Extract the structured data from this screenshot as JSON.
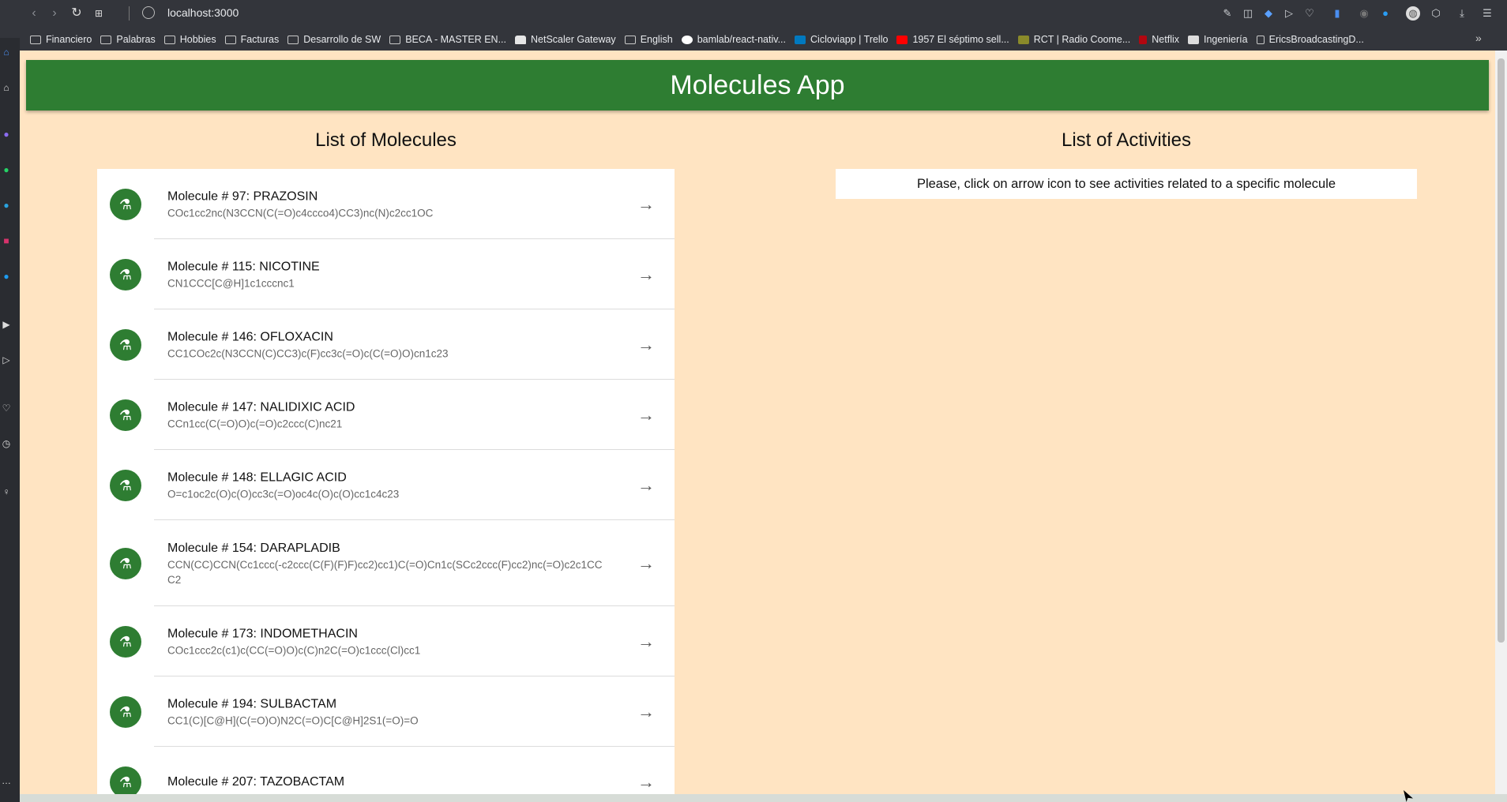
{
  "browser": {
    "url": "localhost:3000",
    "bookmarks": [
      {
        "label": "Financiero",
        "icon": "folder-icon"
      },
      {
        "label": "Palabras",
        "icon": "folder-icon"
      },
      {
        "label": "Hobbies",
        "icon": "folder-icon"
      },
      {
        "label": "Facturas",
        "icon": "folder-icon"
      },
      {
        "label": "Desarrollo de SW",
        "icon": "folder-icon"
      },
      {
        "label": "BECA - MASTER EN...",
        "icon": "folder-icon"
      },
      {
        "label": "NetScaler Gateway",
        "icon": "lock-icon"
      },
      {
        "label": "English",
        "icon": "folder-icon"
      },
      {
        "label": "bamlab/react-nativ...",
        "icon": "github-icon"
      },
      {
        "label": "Cicloviapp | Trello",
        "icon": "trello-icon"
      },
      {
        "label": "1957 El séptimo sell...",
        "icon": "youtube-icon"
      },
      {
        "label": "RCT | Radio Coome...",
        "icon": "rct-icon"
      },
      {
        "label": "Netflix",
        "icon": "netflix-icon"
      },
      {
        "label": "Ingeniería",
        "icon": "page-icon"
      },
      {
        "label": "EricsBroadcastingD...",
        "icon": "page-icon"
      }
    ]
  },
  "app": {
    "title": "Molecules App",
    "molecules_heading": "List of Molecules",
    "activities_heading": "List of Activities",
    "activities_hint": "Please, click on arrow icon to see activities related to a specific molecule",
    "molecules": [
      {
        "title": "Molecule # 97: PRAZOSIN",
        "smiles": "COc1cc2nc(N3CCN(C(=O)c4ccco4)CC3)nc(N)c2cc1OC"
      },
      {
        "title": "Molecule # 115: NICOTINE",
        "smiles": "CN1CCC[C@H]1c1cccnc1"
      },
      {
        "title": "Molecule # 146: OFLOXACIN",
        "smiles": "CC1COc2c(N3CCN(C)CC3)c(F)cc3c(=O)c(C(=O)O)cn1c23"
      },
      {
        "title": "Molecule # 147: NALIDIXIC ACID",
        "smiles": "CCn1cc(C(=O)O)c(=O)c2ccc(C)nc21"
      },
      {
        "title": "Molecule # 148: ELLAGIC ACID",
        "smiles": "O=c1oc2c(O)c(O)cc3c(=O)oc4c(O)c(O)cc1c4c23"
      },
      {
        "title": "Molecule # 154: DARAPLADIB",
        "smiles": "CCN(CC)CCN(Cc1ccc(-c2ccc(C(F)(F)F)cc2)cc1)C(=O)Cn1c(SCc2ccc(F)cc2)nc(=O)c2c1CCC2"
      },
      {
        "title": "Molecule # 173: INDOMETHACIN",
        "smiles": "COc1ccc2c(c1)c(CC(=O)O)c(C)n2C(=O)c1ccc(Cl)cc1"
      },
      {
        "title": "Molecule # 194: SULBACTAM",
        "smiles": "CC1(C)[C@H](C(=O)O)N2C(=O)C[C@H]2S1(=O)=O"
      },
      {
        "title": "Molecule # 207: TAZOBACTAM",
        "smiles": ""
      }
    ]
  }
}
